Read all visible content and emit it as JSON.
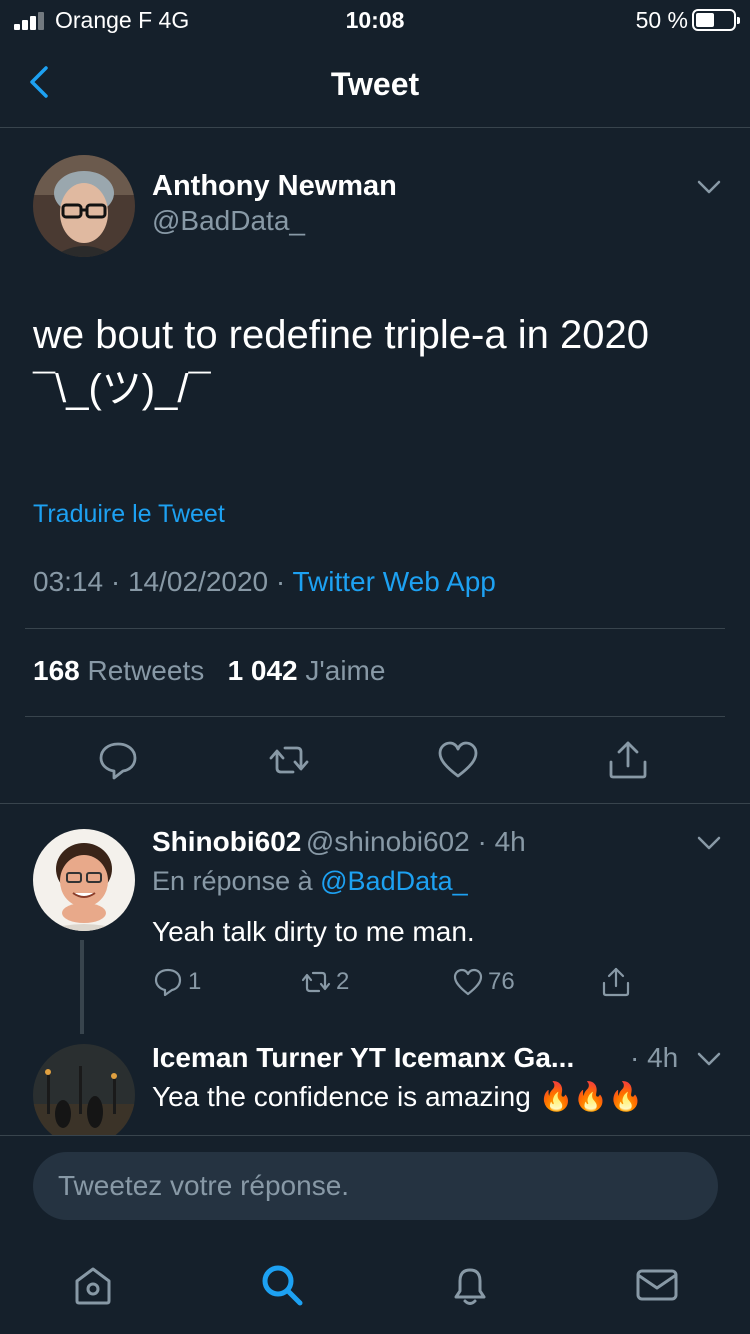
{
  "status_bar": {
    "carrier": "Orange F  4G",
    "time": "10:08",
    "battery": "50 %"
  },
  "nav": {
    "title": "Tweet"
  },
  "tweet": {
    "author_name": "Anthony Newman",
    "author_handle": "@BadData_",
    "text_line1": "we bout to redefine triple-a in 2020",
    "text_line2": "¯\\_(ツ)_/¯",
    "translate_label": "Traduire le Tweet",
    "time": "03:14",
    "date": "14/02/2020",
    "separator": " · ",
    "source": "Twitter Web App",
    "retweets_count": "168",
    "retweets_label": "Retweets",
    "likes_count": "1 042",
    "likes_label": "J'aime"
  },
  "replies": [
    {
      "name": "Shinobi602",
      "handle": "@shinobi602",
      "time": " · 4h",
      "reply_prefix": "En réponse à",
      "reply_to": "@BadData_",
      "text": "Yeah talk dirty to me man.",
      "comments": "1",
      "retweets": "2",
      "likes": "76"
    },
    {
      "name": "Iceman Turner YT Icemanx Ga...",
      "time": "· 4h",
      "text": "Yea the confidence is amazing",
      "emoji": "🔥🔥🔥"
    }
  ],
  "composer": {
    "placeholder": "Tweetez votre réponse."
  },
  "colors": {
    "background": "#15202b",
    "accent": "#1da1f2",
    "muted": "#8899a6",
    "divider": "#38444d"
  },
  "icons": {
    "tab_home": "home-icon",
    "tab_search": "search-icon",
    "tab_notifications": "bell-icon",
    "tab_messages": "mail-icon"
  }
}
